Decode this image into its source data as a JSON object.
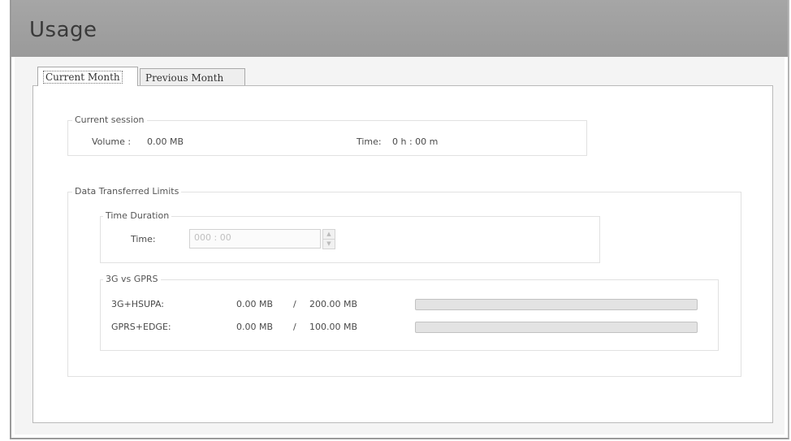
{
  "header": {
    "title": "Usage"
  },
  "tabs": [
    {
      "label": "Current Month",
      "active": true
    },
    {
      "label": "Previous Month",
      "active": false
    }
  ],
  "current_session": {
    "title": "Current session",
    "volume_label": "Volume :",
    "volume_value": "0.00 MB",
    "time_label": "Time:",
    "time_value": "0 h : 00 m"
  },
  "limits": {
    "title": "Data Transferred Limits",
    "time_duration": {
      "title": "Time Duration",
      "time_label": "Time:",
      "time_value": "000 : 00"
    },
    "network": {
      "title": "3G vs GPRS",
      "rows": [
        {
          "label": "3G+HSUPA:",
          "used": "0.00 MB",
          "separator": "/",
          "limit": "200.00 MB",
          "progress": 0
        },
        {
          "label": "GPRS+EDGE:",
          "used": "0.00 MB",
          "separator": "/",
          "limit": "100.00 MB",
          "progress": 0
        }
      ]
    }
  },
  "colors": {
    "header_bg": "#9a9a9a",
    "panel_bg": "#f4f4f4",
    "bar_track": "#e3e3e3"
  }
}
